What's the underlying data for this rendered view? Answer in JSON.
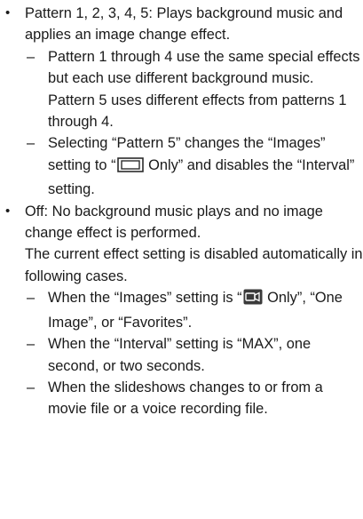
{
  "bullets": {
    "symbol": "•",
    "dash": "–"
  },
  "item1": {
    "text": "Pattern 1, 2, 3, 4, 5: Plays background music and applies an image change effect.",
    "sub1": "Pattern 1 through 4 use the same special effects but each use different background music. Pattern 5 uses different effects from patterns 1 through 4.",
    "sub2_a": "Selecting “Pattern 5” changes the “Images” setting to “",
    "sub2_b": " Only” and disables the “Interval” setting."
  },
  "item2": {
    "text": "Off: No background music plays and no image change effect is performed.",
    "note": "The current effect setting is disabled automatically in following cases.",
    "sub1_a": "When the “Images” setting is “",
    "sub1_b": " Only”, “One Image”, or “Favorites”.",
    "sub2": "When the “Interval” setting is “MAX”, one second, or two seconds.",
    "sub3": "When the slideshows changes to or from a movie file or a voice recording file."
  },
  "icons": {
    "photo_icon": "photo-mode-icon",
    "movie_icon": "movie-mode-icon",
    "icon_color": "#2b2b2b"
  }
}
